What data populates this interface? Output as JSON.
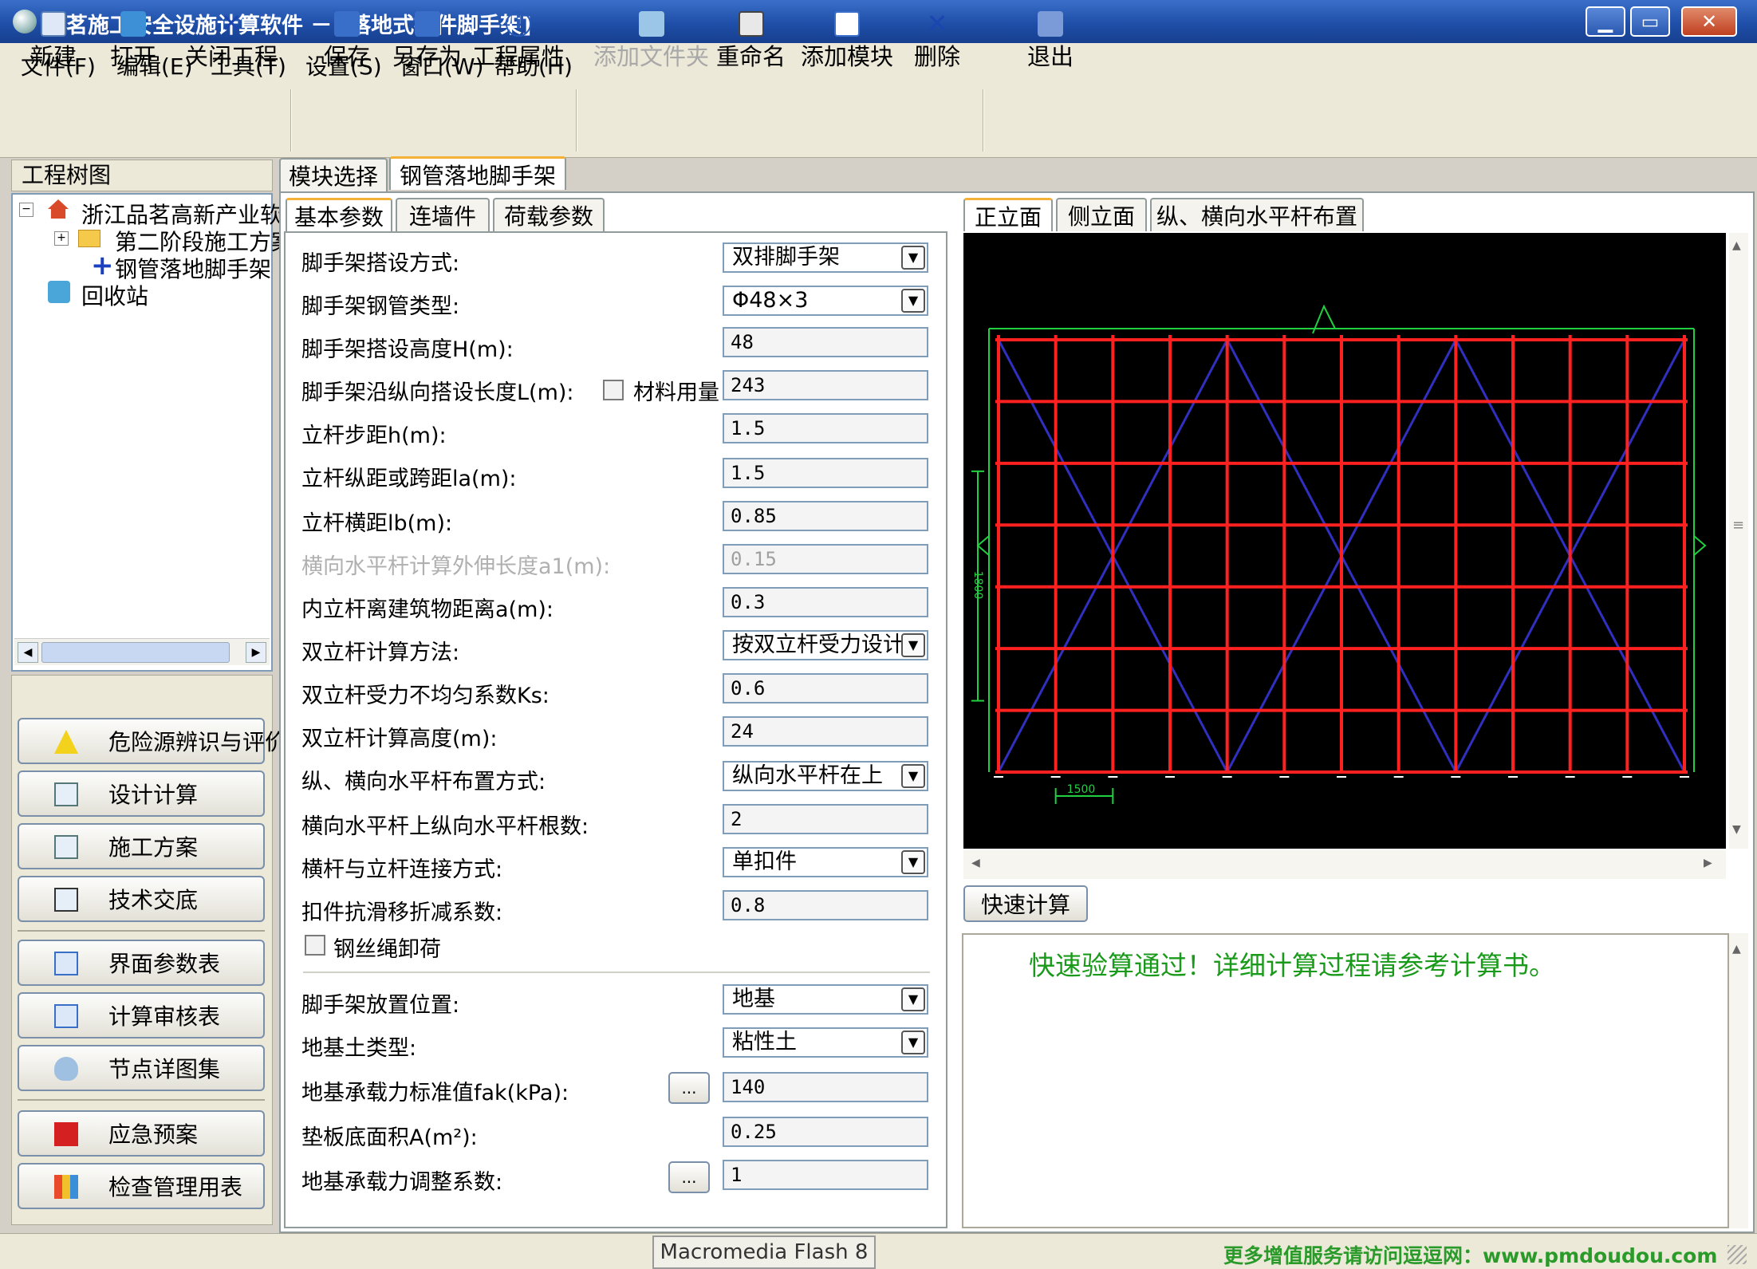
{
  "window": {
    "title": "品茗施工安全设施计算软件 － [落地式扣件脚手架]",
    "controls": [
      "▁",
      "▭",
      "✕"
    ]
  },
  "menu": [
    "文件(F)",
    "编辑(E)",
    "工具(T)",
    "设置(S)",
    "窗口(W)",
    "帮助(H)"
  ],
  "toolbar": {
    "new": "新建",
    "open": "打开",
    "close_project": "关闭工程",
    "save": "保存",
    "save_as": "另存为",
    "project_props": "工程属性",
    "add_folder": "添加文件夹",
    "rename": "重命名",
    "add_module": "添加模块",
    "delete": "删除",
    "exit": "退出"
  },
  "left": {
    "tree_title": "工程树图",
    "tree": [
      "浙江品茗高新产业软件",
      "第二阶段施工方案",
      "钢管落地脚手架",
      "回收站"
    ],
    "buttons": [
      "危险源辨识与评价",
      "设计计算",
      "施工方案",
      "技术交底",
      "界面参数表",
      "计算审核表",
      "节点详图集",
      "应急预案",
      "检查管理用表"
    ]
  },
  "doc_tabs": [
    "模块选择",
    "钢管落地脚手架"
  ],
  "param_tabs": [
    "基本参数",
    "连墙件",
    "荷载参数"
  ],
  "view_tabs": [
    "正立面",
    "侧立面",
    "纵、横向水平杆布置"
  ],
  "form": {
    "erect_mode_label": "脚手架搭设方式:",
    "erect_mode": "双排脚手架",
    "tube_type_label": "脚手架钢管类型:",
    "tube_type": "Φ48×3",
    "height_label": "脚手架搭设高度H(m):",
    "height": "48",
    "length_label": "脚手架沿纵向搭设长度L(m):",
    "material_label": "材料用量",
    "length": "243",
    "step_label": "立杆步距h(m):",
    "step": "1.5",
    "long_spacing_label": "立杆纵距或跨距la(m):",
    "long_spacing": "1.5",
    "trans_spacing_label": "立杆横距lb(m):",
    "trans_spacing": "0.85",
    "overhang_label": "横向水平杆计算外伸长度a1(m):",
    "overhang": "0.15",
    "inner_dist_label": "内立杆离建筑物距离a(m):",
    "inner_dist": "0.3",
    "double_method_label": "双立杆计算方法:",
    "double_method": "按双立杆受力设计",
    "ks_label": "双立杆受力不均匀系数Ks:",
    "ks": "0.6",
    "double_height_label": "双立杆计算高度(m):",
    "double_height": "24",
    "bar_layout_label": "纵、横向水平杆布置方式:",
    "bar_layout": "纵向水平杆在上",
    "bar_count_label": "横向水平杆上纵向水平杆根数:",
    "bar_count": "2",
    "connect_label": "横杆与立杆连接方式:",
    "connect": "单扣件",
    "slip_label": "扣件抗滑移折减系数:",
    "slip": "0.8",
    "wire_label": "钢丝绳卸荷",
    "base_pos_label": "脚手架放置位置:",
    "base_pos": "地基",
    "soil_label": "地基土类型:",
    "soil": "粘性土",
    "fak_label": "地基承载力标准值fak(kPa):",
    "fak": "140",
    "plate_label": "垫板底面积A(m²):",
    "plate": "0.25",
    "adjust_label": "地基承载力调整系数:",
    "adjust": "1",
    "dots": "..."
  },
  "drawing": {
    "dim_vertical": "1800",
    "dim_horizontal": "1500"
  },
  "quick_calc": "快速计算",
  "result_message": "快速验算通过！详细计算过程请参考计算书。",
  "status": {
    "flash": "Macromedia Flash 8",
    "promo": "更多增值服务请访问逗逗网：www.pmdoudou.com"
  },
  "colors": {
    "grid_red": "#ff2020",
    "diag_blue": "#3030c0",
    "dim_green": "#20d040",
    "msg_green": "#1a9a1a"
  }
}
